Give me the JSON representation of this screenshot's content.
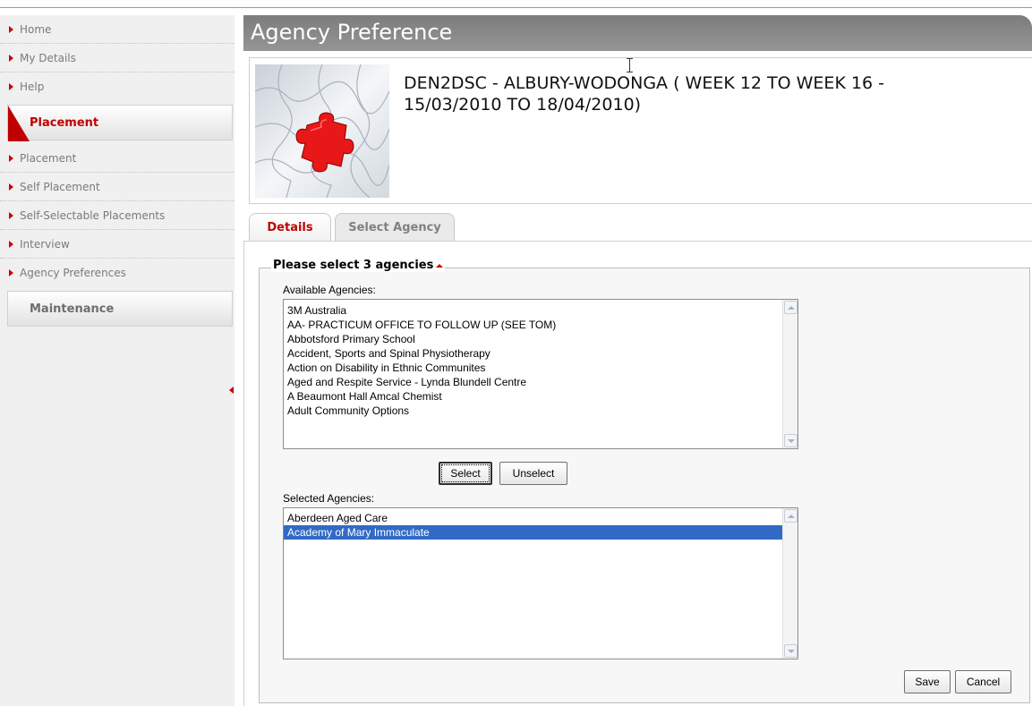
{
  "sidebar": {
    "top_items": [
      {
        "label": "Home"
      },
      {
        "label": "My Details"
      },
      {
        "label": "Help"
      }
    ],
    "placement_section": {
      "label": "Placement",
      "items": [
        {
          "label": "Placement"
        },
        {
          "label": "Self Placement"
        },
        {
          "label": "Self-Selectable Placements"
        },
        {
          "label": "Interview"
        },
        {
          "label": "Agency Preferences"
        }
      ]
    },
    "maintenance_section": {
      "label": "Maintenance"
    }
  },
  "page": {
    "title": "Agency Preference",
    "program_title": "DEN2DSC - ALBURY-WODONGA ( WEEK 12 TO WEEK 16 - 15/03/2010 TO 18/04/2010)"
  },
  "tabs": [
    {
      "label": "Details",
      "active": true
    },
    {
      "label": "Select Agency",
      "active": false
    }
  ],
  "form": {
    "legend": "Please select 3 agencies",
    "available_label": "Available Agencies:",
    "available_agencies": [
      "3M Australia",
      "AA- PRACTICUM OFFICE TO FOLLOW UP (SEE TOM)",
      "Abbotsford Primary School",
      "Accident, Sports and Spinal Physiotherapy",
      "Action on Disability in Ethnic Communites",
      "Aged and Respite Service - Lynda Blundell Centre",
      "A Beaumont Hall Amcal Chemist",
      "Adult Community Options"
    ],
    "select_button": "Select",
    "unselect_button": "Unselect",
    "selected_label": "Selected Agencies:",
    "selected_agencies": [
      "Aberdeen Aged Care",
      "Academy of Mary Immaculate"
    ],
    "save_button": "Save",
    "cancel_button": "Cancel"
  },
  "colors": {
    "accent": "#c00000",
    "title_bar": "#8a8a8a",
    "selection": "#316ac5"
  }
}
